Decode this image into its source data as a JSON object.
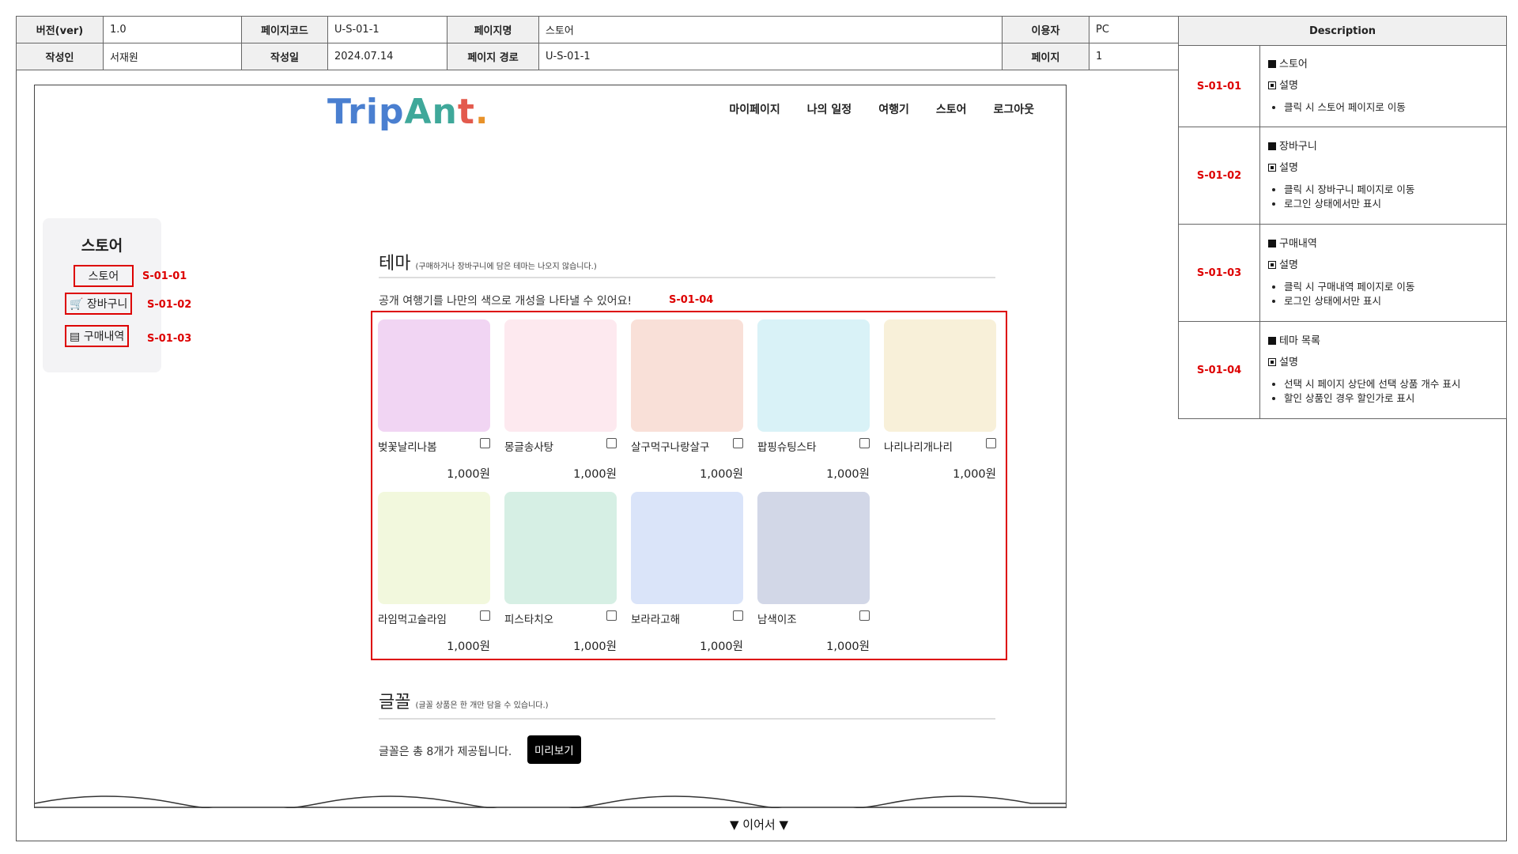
{
  "header": {
    "version_label": "버전(ver)",
    "version": "1.0",
    "pagecode_label": "페이지코드",
    "pagecode": "U-S-01-1",
    "pagename_label": "페이지명",
    "pagename": "스토어",
    "user_label": "이용자",
    "user": "PC",
    "author_label": "작성인",
    "author": "서재원",
    "date_label": "작성일",
    "date": "2024.07.14",
    "path_label": "페이지 경로",
    "path": "U-S-01-1",
    "page_label": "페이지",
    "page": "1"
  },
  "description": {
    "title": "Description",
    "rows": [
      {
        "id": "S-01-01",
        "heading": "스토어",
        "sub": "설명",
        "bullets": [
          "클릭 시 스토어 페이지로 이동"
        ]
      },
      {
        "id": "S-01-02",
        "heading": "장바구니",
        "sub": "설명",
        "bullets": [
          "클릭 시 장바구니 페이지로 이동",
          "로그인 상태에서만 표시"
        ]
      },
      {
        "id": "S-01-03",
        "heading": "구매내역",
        "sub": "설명",
        "bullets": [
          "클릭 시 구매내역 페이지로 이동",
          "로그인 상태에서만 표시"
        ]
      },
      {
        "id": "S-01-04",
        "heading": "테마 목록",
        "sub": "설명",
        "bullets": [
          "선택 시 페이지 상단에 선택 상품 개수 표시",
          "할인 상품인 경우 할인가로 표시"
        ]
      }
    ]
  },
  "app": {
    "logo": {
      "p1": "Trip",
      "p2": "An",
      "p3": "t",
      "p4": "."
    },
    "nav": [
      "마이페이지",
      "나의 일정",
      "여행기",
      "스토어",
      "로그아웃"
    ]
  },
  "sidebar": {
    "title": "스토어",
    "items": [
      {
        "label": "스토어",
        "tag": "S-01-01"
      },
      {
        "label": "장바구니",
        "tag": "S-01-02"
      },
      {
        "label": "구매내역",
        "tag": "S-01-03"
      }
    ]
  },
  "theme": {
    "title": "테마",
    "note": "(구매하거나 장바구니에 담은 테마는 나오지 않습니다.)",
    "lead": "공개 여행기를 나만의 색으로 개성을 나타낼 수 있어요!",
    "tag": "S-01-04",
    "items": [
      {
        "name": "벚꽃날리나봄",
        "price": "1,000원",
        "color": "#f1d5f3"
      },
      {
        "name": "몽글송사탕",
        "price": "1,000원",
        "color": "#fde9ef"
      },
      {
        "name": "살구먹구나랑살구",
        "price": "1,000원",
        "color": "#f9e0d8"
      },
      {
        "name": "팝핑슈팅스타",
        "price": "1,000원",
        "color": "#d9f2f7"
      },
      {
        "name": "나리나리개나리",
        "price": "1,000원",
        "color": "#f8f0d9"
      },
      {
        "name": "라임먹고슬라임",
        "price": "1,000원",
        "color": "#f2f8dd"
      },
      {
        "name": "피스타치오",
        "price": "1,000원",
        "color": "#d6efe4"
      },
      {
        "name": "보라라고해",
        "price": "1,000원",
        "color": "#dae4f9"
      },
      {
        "name": "남색이조",
        "price": "1,000원",
        "color": "#d2d7e7"
      }
    ]
  },
  "font": {
    "title": "글꼴",
    "note": "(글꼴 상품은 한 개만 담을 수 있습니다.)",
    "lead": "글꼴은 총 8개가 제공됩니다.",
    "preview_btn": "미리보기"
  },
  "continue": "▼ 이어서 ▼"
}
